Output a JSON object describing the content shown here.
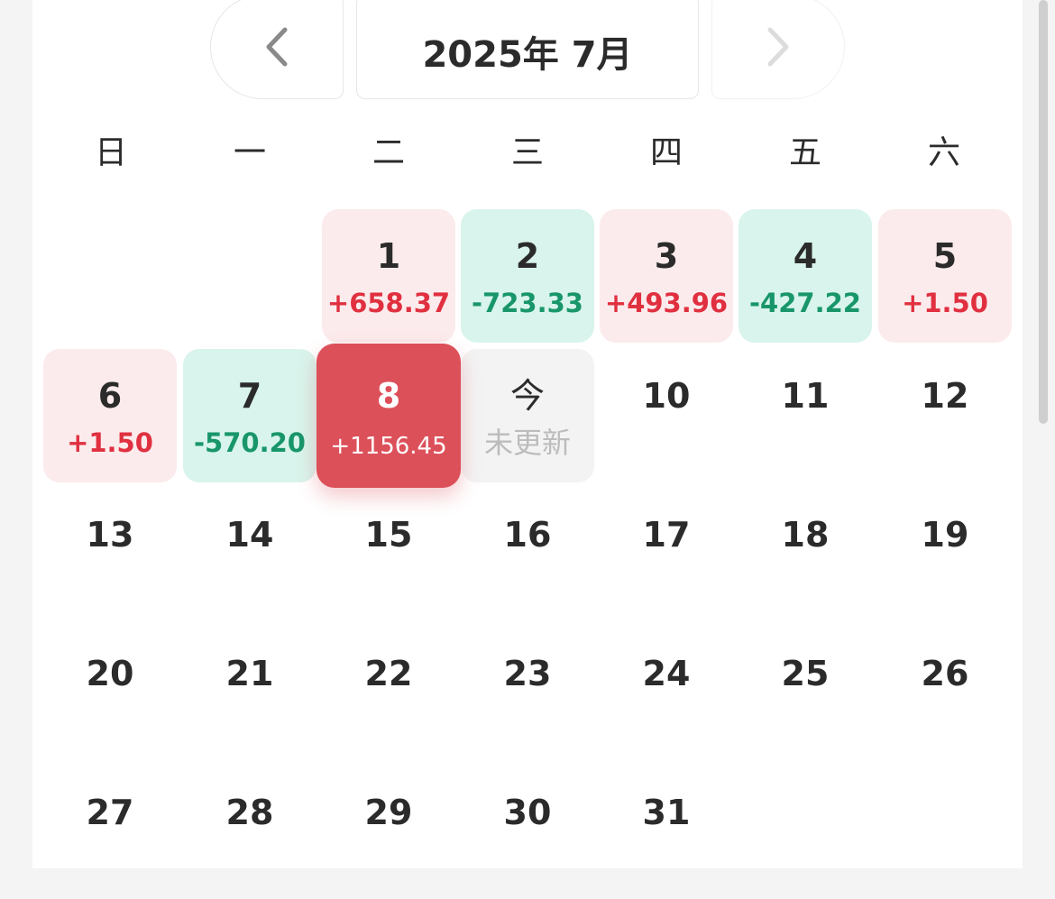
{
  "header": {
    "month_label": "2025年 7月",
    "prev_icon": "chevron-left-icon",
    "next_icon": "chevron-right-icon"
  },
  "weekdays": [
    "日",
    "一",
    "二",
    "三",
    "四",
    "五",
    "六"
  ],
  "days": {
    "d1": {
      "day": "1",
      "value": "+658.37"
    },
    "d2": {
      "day": "2",
      "value": "-723.33"
    },
    "d3": {
      "day": "3",
      "value": "+493.96"
    },
    "d4": {
      "day": "4",
      "value": "-427.22"
    },
    "d5": {
      "day": "5",
      "value": "+1.50"
    },
    "d6": {
      "day": "6",
      "value": "+1.50"
    },
    "d7": {
      "day": "7",
      "value": "-570.20"
    },
    "d8": {
      "day": "8",
      "value": "+1156.45"
    },
    "today": {
      "day": "今",
      "value": "未更新"
    },
    "d10": {
      "day": "10"
    },
    "d11": {
      "day": "11"
    },
    "d12": {
      "day": "12"
    },
    "d13": {
      "day": "13"
    },
    "d14": {
      "day": "14"
    },
    "d15": {
      "day": "15"
    },
    "d16": {
      "day": "16"
    },
    "d17": {
      "day": "17"
    },
    "d18": {
      "day": "18"
    },
    "d19": {
      "day": "19"
    },
    "d20": {
      "day": "20"
    },
    "d21": {
      "day": "21"
    },
    "d22": {
      "day": "22"
    },
    "d23": {
      "day": "23"
    },
    "d24": {
      "day": "24"
    },
    "d25": {
      "day": "25"
    },
    "d26": {
      "day": "26"
    },
    "d27": {
      "day": "27"
    },
    "d28": {
      "day": "28"
    },
    "d29": {
      "day": "29"
    },
    "d30": {
      "day": "30"
    },
    "d31": {
      "day": "31"
    }
  },
  "colors": {
    "gain": "#e03040",
    "loss": "#18966a",
    "gain_bg": "#fcebec",
    "loss_bg": "#d8f4ec",
    "selected_bg": "#dc505a"
  }
}
